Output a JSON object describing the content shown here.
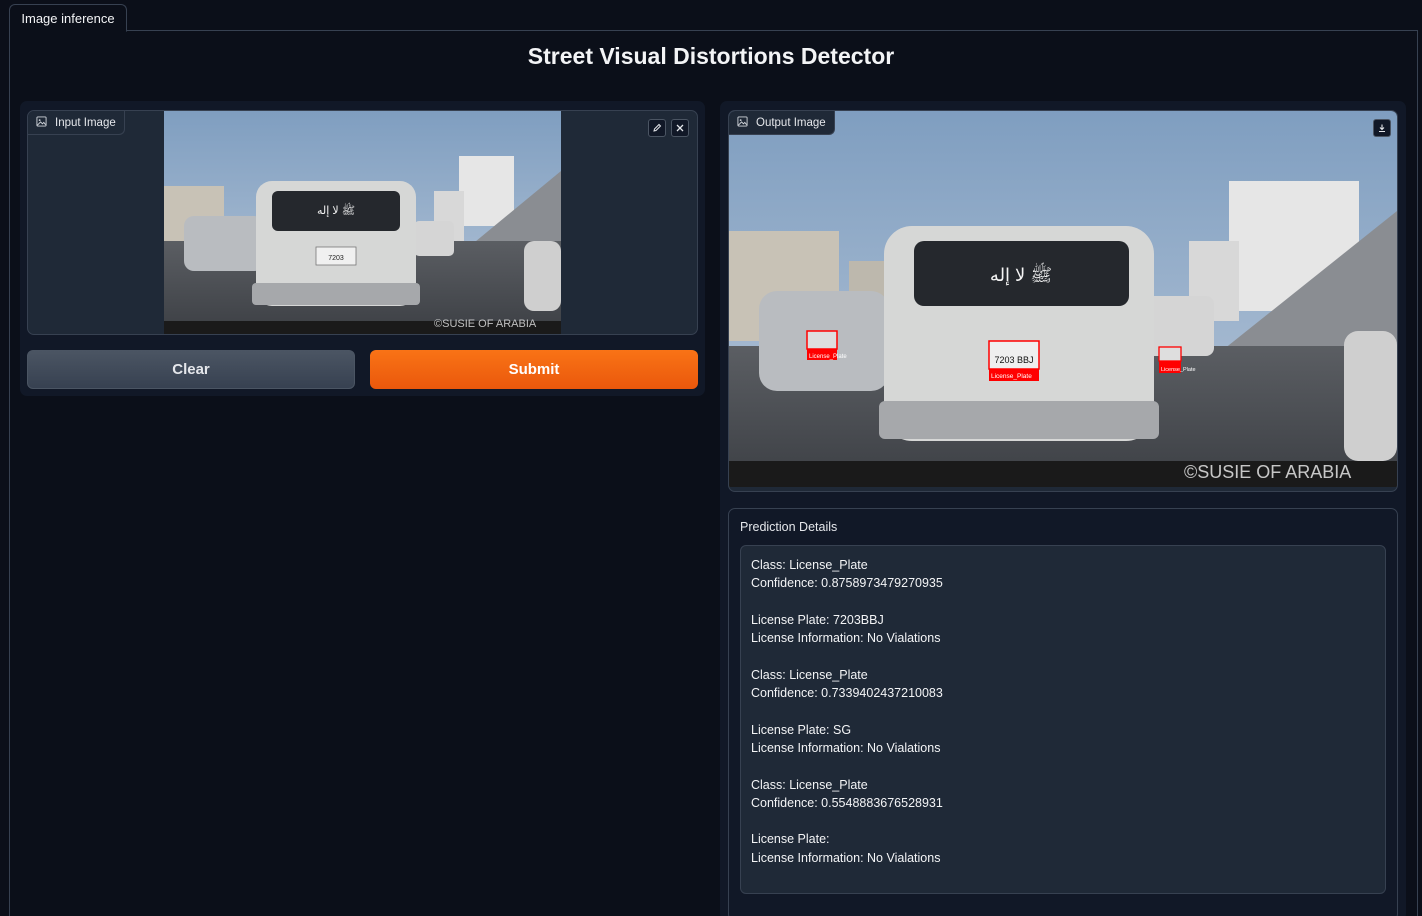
{
  "tabs": [
    {
      "label": "Image inference"
    }
  ],
  "page": {
    "title": "Street Visual Distortions Detector"
  },
  "input_image": {
    "label": "Input Image",
    "watermark": "©SUSIE OF ARABIA"
  },
  "output_image": {
    "label": "Output Image",
    "watermark": "©SUSIE OF ARABIA",
    "detections": [
      {
        "label": "License_Plate",
        "plate_text": "7203 BBJ"
      },
      {
        "label": "License_Plate",
        "plate_text": ""
      },
      {
        "label": "License_Plate",
        "plate_text": ""
      }
    ]
  },
  "buttons": {
    "clear": "Clear",
    "submit": "Submit"
  },
  "prediction": {
    "title": "Prediction Details",
    "text": "Class: License_Plate\nConfidence: 0.8758973479270935\n\nLicense Plate: 7203BBJ\nLicense Information: No Vialations\n\nClass: License_Plate\nConfidence: 0.7339402437210083\n\nLicense Plate: SG\nLicense Information: No Vialations\n\nClass: License_Plate\nConfidence: 0.5548883676528931\n\nLicense Plate:\nLicense Information: No Vialations"
  },
  "colors": {
    "accent": "#f97316",
    "background": "#0b0f19",
    "box": "#ff0000"
  },
  "icons": [
    "image-icon",
    "edit-icon",
    "close-icon",
    "download-icon"
  ]
}
